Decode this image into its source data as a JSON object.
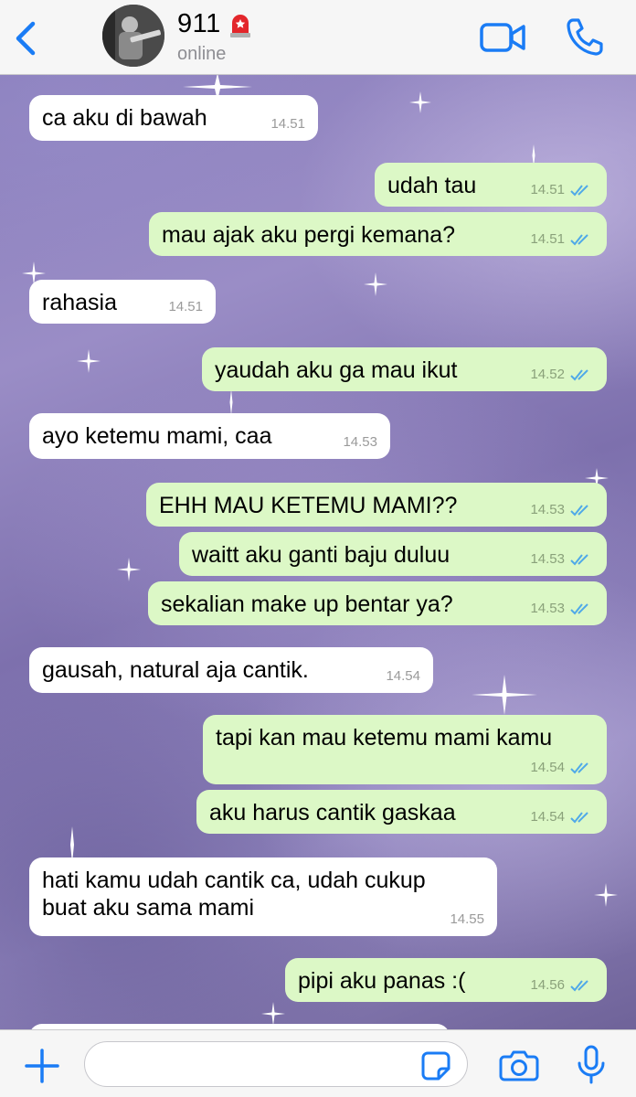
{
  "header": {
    "contact_name": "911",
    "status": "online",
    "icons": {
      "back": "chevron-left-icon",
      "emoji": "rotating-light-icon",
      "video": "video-camera-icon",
      "call": "phone-icon"
    },
    "accent_color": "#1a7cf5"
  },
  "messages": [
    {
      "dir": "in",
      "text": "ca aku di bawah",
      "time": "14.51"
    },
    {
      "dir": "out",
      "text": "udah tau",
      "time": "14.51"
    },
    {
      "dir": "out",
      "text": "mau ajak aku pergi kemana?",
      "time": "14.51"
    },
    {
      "dir": "in",
      "text": "rahasia",
      "time": "14.51"
    },
    {
      "dir": "out",
      "text": "yaudah aku ga mau ikut",
      "time": "14.52"
    },
    {
      "dir": "in",
      "text": "ayo ketemu mami, caa",
      "time": "14.53"
    },
    {
      "dir": "out",
      "text": "EHH MAU KETEMU MAMI??",
      "time": "14.53"
    },
    {
      "dir": "out",
      "text": "waitt aku ganti baju duluu",
      "time": "14.53"
    },
    {
      "dir": "out",
      "text": "sekalian make up bentar ya?",
      "time": "14.53"
    },
    {
      "dir": "in",
      "text": "gausah, natural aja cantik.",
      "time": "14.54"
    },
    {
      "dir": "out",
      "text": "tapi kan mau ketemu mami kamu",
      "time": "14.54"
    },
    {
      "dir": "out",
      "text": "aku harus cantik gaskaa",
      "time": "14.54"
    },
    {
      "dir": "in",
      "text": "hati kamu udah cantik ca, udah cukup\nbuat aku sama mami",
      "time": "14.55"
    },
    {
      "dir": "out",
      "text": "pipi aku panas :(",
      "time": "14.56"
    }
  ],
  "composer": {
    "placeholder": "",
    "icons": {
      "attach": "plus-icon",
      "sticker": "sticker-icon",
      "camera": "camera-icon",
      "mic": "microphone-icon"
    }
  },
  "colors": {
    "incoming": "#ffffff",
    "outgoing": "#dcf8c6",
    "read_ticks": "#4fa9e8"
  }
}
